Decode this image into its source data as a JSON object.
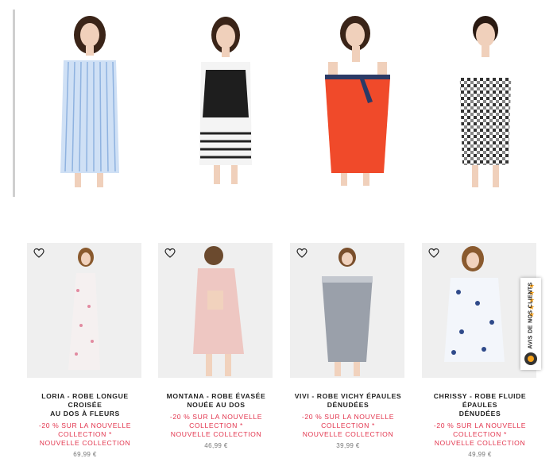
{
  "products": [
    {
      "title_line1": "LORIA - ROBE LONGUE CROISÉE",
      "title_line2": "AU DOS À FLEURS",
      "promo_line1": "-20 % SUR LA NOUVELLE",
      "promo_line2": "COLLECTION *",
      "promo_line3": "NOUVELLE COLLECTION",
      "price": "69,99 €"
    },
    {
      "title_line1": "MONTANA - ROBE ÉVASÉE",
      "title_line2": "NOUÉE AU DOS",
      "promo_line1": "-20 % SUR LA NOUVELLE",
      "promo_line2": "COLLECTION *",
      "promo_line3": "NOUVELLE COLLECTION",
      "price": "46,99 €"
    },
    {
      "title_line1": "VIVI - ROBE VICHY ÉPAULES",
      "title_line2": "DÉNUDÉES",
      "promo_line1": "-20 % SUR LA NOUVELLE",
      "promo_line2": "COLLECTION *",
      "promo_line3": "NOUVELLE COLLECTION",
      "price": "39,99 €"
    },
    {
      "title_line1": "CHRISSY - ROBE FLUIDE ÉPAULES",
      "title_line2": "DÉNUDÉES",
      "promo_line1": "-20 % SUR LA NOUVELLE",
      "promo_line2": "COLLECTION *",
      "promo_line3": "NOUVELLE COLLECTION",
      "price": "49,99 €"
    }
  ],
  "reviews_tab": {
    "label": "AVIS DE NOS CLIENTS",
    "stars": "★★★★★"
  },
  "icons": {
    "wishlist": "heart-outline-icon",
    "reviews_logo": "verified-reviews-logo-icon"
  },
  "colors": {
    "promo": "#e2344d",
    "stars": "#f7a21b",
    "photo_bg": "#efefef"
  }
}
